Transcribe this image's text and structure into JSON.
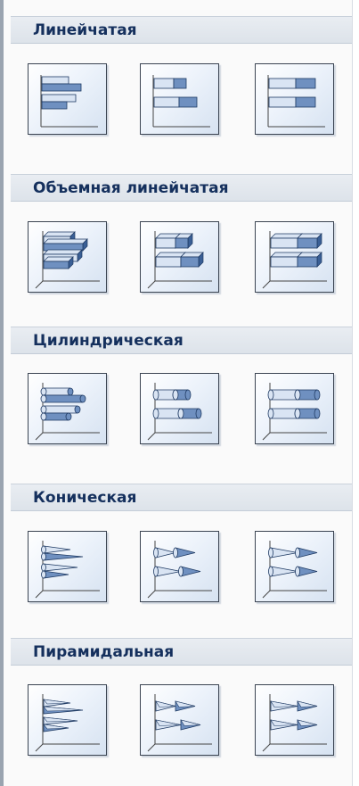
{
  "sections": [
    {
      "title": "Линейчатая",
      "items": [
        {
          "icon": "clustered-bar-chart-icon"
        },
        {
          "icon": "stacked-bar-chart-icon"
        },
        {
          "icon": "100-stacked-bar-chart-icon"
        }
      ]
    },
    {
      "title": "Объемная линейчатая",
      "items": [
        {
          "icon": "3d-clustered-bar-chart-icon"
        },
        {
          "icon": "3d-stacked-bar-chart-icon"
        },
        {
          "icon": "3d-100-stacked-bar-chart-icon"
        }
      ]
    },
    {
      "title": "Цилиндрическая",
      "items": [
        {
          "icon": "clustered-cylinder-bar-chart-icon"
        },
        {
          "icon": "stacked-cylinder-bar-chart-icon"
        },
        {
          "icon": "100-stacked-cylinder-bar-chart-icon"
        }
      ]
    },
    {
      "title": "Коническая",
      "items": [
        {
          "icon": "clustered-cone-bar-chart-icon"
        },
        {
          "icon": "stacked-cone-bar-chart-icon"
        },
        {
          "icon": "100-stacked-cone-bar-chart-icon"
        }
      ]
    },
    {
      "title": "Пирамидальная",
      "items": [
        {
          "icon": "clustered-pyramid-bar-chart-icon"
        },
        {
          "icon": "stacked-pyramid-bar-chart-icon"
        },
        {
          "icon": "100-stacked-pyramid-bar-chart-icon"
        }
      ]
    }
  ],
  "colors": {
    "header_text": "#15305d",
    "bar_dark": "#3a5f95",
    "bar_mid": "#6f90c0",
    "bar_light": "#d9e4f3",
    "thumb_border": "#3b4452"
  }
}
